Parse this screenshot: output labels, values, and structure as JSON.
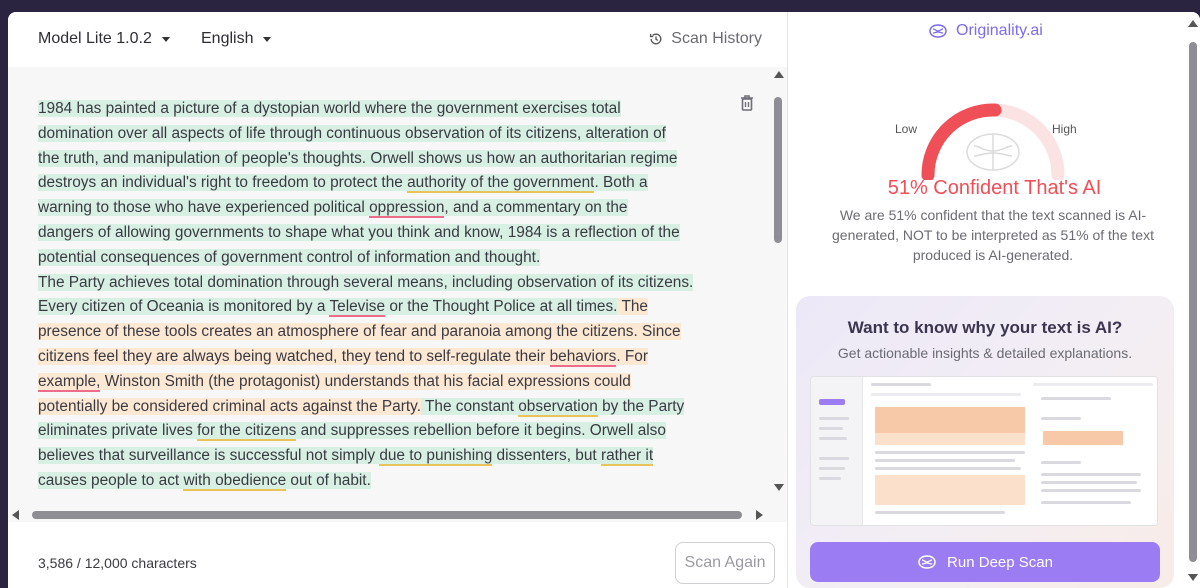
{
  "toolbar": {
    "model": "Model Lite 1.0.2",
    "language": "English",
    "history": "Scan History"
  },
  "editor": {
    "p": [
      "1984 has painted a picture of a dystopian world where the government exercises total",
      "domination over all aspects of life through continuous observation of its citizens, alteration of",
      "the truth, and manipulation of people's thoughts. Orwell shows us how an authoritarian regime",
      "destroys an individual's right to freedom to protect the ",
      "authority of the government",
      ". Both a",
      "warning to those who have experienced political ",
      "oppression",
      ", and a commentary on the",
      "dangers of allowing governments to shape what you think and know, 1984 is a reflection of the",
      "potential consequences of government control of information and thought.",
      "The Party achieves total domination through several means, including observation of its citizens.",
      "Every citizen of Oceania is monitored by a ",
      "Televise",
      " or the Thought Police at all times.",
      " The",
      "presence of these tools creates an atmosphere of fear and paranoia among the citizens. Since",
      "citizens feel they are always being watched, they tend to self-regulate their ",
      "behaviors",
      ". For",
      "example,",
      " Winston Smith (the protagonist) understands that his facial expressions could",
      "potentially be considered criminal acts against the Party.",
      " The constant ",
      "observation",
      " by the Party",
      "eliminates private lives ",
      "for the citizens",
      " and suppresses rebellion before it begins.",
      " Orwell also",
      "believes that surveillance is successful not simply ",
      "due to punishing",
      " dissenters, but ",
      "rather it",
      "causes people to act ",
      "with obedience",
      " out of habit."
    ],
    "char_count": "3,586 / 12,000 characters",
    "scan_again": "Scan Again"
  },
  "result": {
    "brand": "Originality.ai",
    "low": "Low",
    "high": "High",
    "confidence_percent": 51,
    "title": "51% Confident That's AI",
    "description": "We are 51% confident that the text scanned is AI-generated, NOT to be interpreted as 51% of the text produced is AI-generated."
  },
  "deep_scan": {
    "title": "Want to know why your text is AI?",
    "subtitle": "Get actionable insights & detailed explanations.",
    "button": "Run Deep Scan"
  },
  "colors": {
    "accent": "#9b7cf2",
    "ai_red": "#ef4f57",
    "human_green": "#d8efe4",
    "ai_orange": "#fde8d3"
  }
}
